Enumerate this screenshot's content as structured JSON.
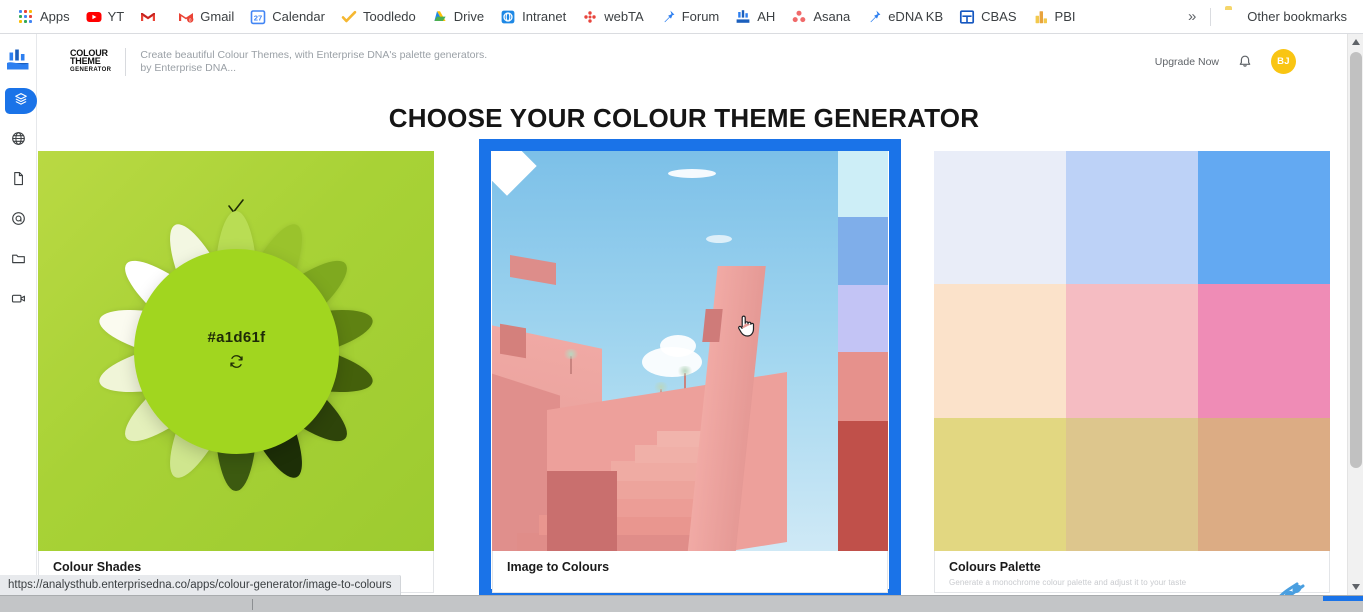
{
  "browser": {
    "bookmarks": [
      {
        "label": "Apps",
        "icon": "apps-grid-icon"
      },
      {
        "label": "YT",
        "icon": "youtube-icon"
      },
      {
        "label": "",
        "icon": "gmail-icon"
      },
      {
        "label": "Gmail",
        "icon": "gmail-icon"
      },
      {
        "label": "Calendar",
        "icon": "calendar-icon"
      },
      {
        "label": "Toodledo",
        "icon": "checkmark-icon"
      },
      {
        "label": "Drive",
        "icon": "google-drive-icon"
      },
      {
        "label": "Intranet",
        "icon": "intranet-icon"
      },
      {
        "label": "webTA",
        "icon": "webta-icon"
      },
      {
        "label": "Forum",
        "icon": "pin-icon"
      },
      {
        "label": "AH",
        "icon": "analysthub-icon"
      },
      {
        "label": "Asana",
        "icon": "asana-icon"
      },
      {
        "label": "eDNA KB",
        "icon": "pin-icon"
      },
      {
        "label": "CBAS",
        "icon": "cbas-icon"
      },
      {
        "label": "PBI",
        "icon": "power-bi-icon"
      }
    ],
    "overflow_label": "»",
    "other_bookmarks_label": "Other bookmarks",
    "status_url": "https://analysthub.enterprisedna.co/apps/colour-generator/image-to-colours"
  },
  "sidebar": {
    "logo_name": "analysthub-logo",
    "items": [
      {
        "name": "sidebar-item-apps",
        "icon": "layers-icon",
        "active": true
      },
      {
        "name": "sidebar-item-web",
        "icon": "globe-icon",
        "active": false
      },
      {
        "name": "sidebar-item-documents",
        "icon": "document-icon",
        "active": false
      },
      {
        "name": "sidebar-item-target",
        "icon": "target-icon",
        "active": false
      },
      {
        "name": "sidebar-item-folders",
        "icon": "folder-icon",
        "active": false
      },
      {
        "name": "sidebar-item-videos",
        "icon": "video-icon",
        "active": false
      }
    ]
  },
  "header": {
    "logo_line1": "COLOUR",
    "logo_line2": "THEME",
    "logo_line3": "GENERATOR",
    "tagline_line1": "Create beautiful Colour Themes, with Enterprise DNA's palette generators.",
    "tagline_line2": "by Enterprise DNA...",
    "upgrade_label": "Upgrade Now",
    "notification_icon": "bell-icon",
    "avatar_initials": "BJ",
    "avatar_color": "#f9c513"
  },
  "main": {
    "title": "CHOOSE YOUR COLOUR THEME GENERATOR",
    "selection_color": "#1a73e8",
    "cards": [
      {
        "name": "Colour Shades",
        "subtitle": "",
        "selected": false,
        "hex_code": "#a1d61f",
        "refresh_icon": "refresh-icon",
        "check_icon": "check-icon",
        "background_color": "#a8d236",
        "petal_colors": [
          "#b9dd54",
          "#9ac32c",
          "#7fa91f",
          "#5f8212",
          "#44600b",
          "#2e440a",
          "#1d2f07",
          "#3c5a10",
          "#cfe68e",
          "#e4f0bb",
          "#f0f5d8",
          "#fbfbf0",
          "#ffffff",
          "#f3f7e2"
        ]
      },
      {
        "name": "Image to Colours",
        "subtitle": "",
        "selected": true,
        "swatches": [
          "#cdeef7",
          "#7faeea",
          "#c3c4f5",
          "#e6918c",
          "#c0504a"
        ]
      },
      {
        "name": "Colours Palette",
        "subtitle": "Generate a monochrome colour palette and adjust it to your taste",
        "selected": false,
        "palette": [
          "#e9edf8",
          "#bdd2f7",
          "#63a9f2",
          "#fbe2ca",
          "#f5bcc2",
          "#ef8cb6",
          "#e2d781",
          "#ddc68d",
          "#dcac84"
        ]
      }
    ]
  },
  "scrollbar": {
    "up_icon": "caret-up-icon",
    "down_icon": "caret-down-icon"
  },
  "footer": {
    "dna_icon": "dna-helix-icon"
  }
}
